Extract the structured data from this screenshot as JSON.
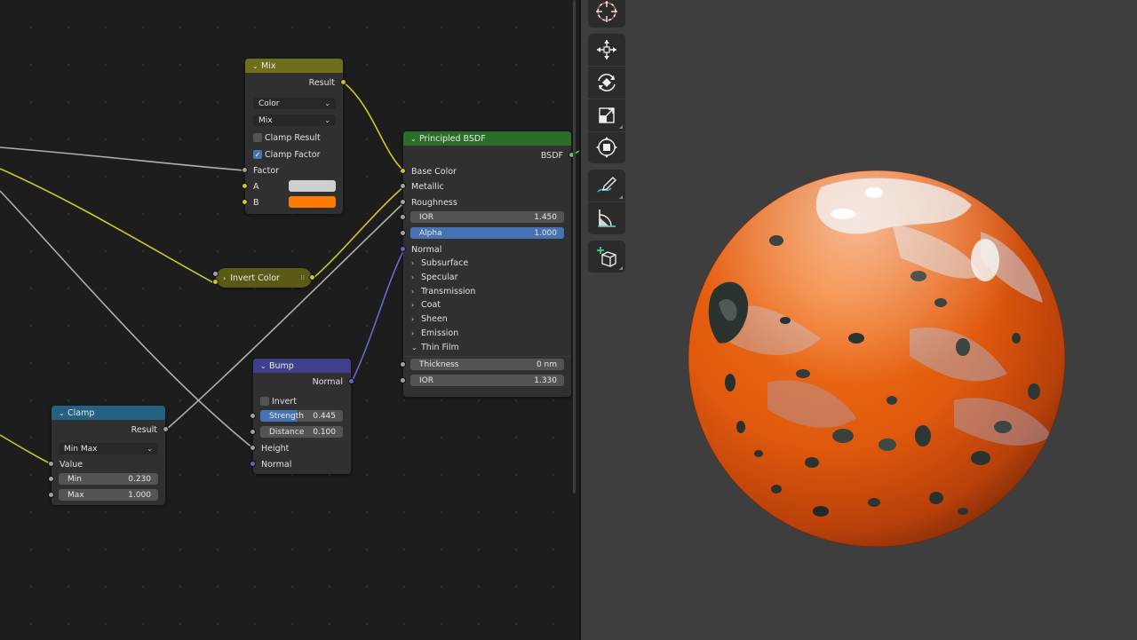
{
  "node_editor": {
    "mix_node": {
      "title": "Mix",
      "output_result": "Result",
      "data_type": "Color",
      "blend_mode": "Mix",
      "clamp_result_label": "Clamp Result",
      "clamp_result_checked": false,
      "clamp_factor_label": "Clamp Factor",
      "clamp_factor_checked": true,
      "input_factor": "Factor",
      "input_a": "A",
      "input_b": "B",
      "color_a": "#cfcfcf",
      "color_b": "#ff7b00",
      "header_color": "#6e6e1c"
    },
    "invert_node": {
      "title": "Invert Color",
      "header_color": "#5a5a17"
    },
    "principled_node": {
      "title": "Principled BSDF",
      "output_bsdf": "BSDF",
      "input_base_color": "Base Color",
      "input_metallic": "Metallic",
      "input_roughness": "Roughness",
      "ior_label": "IOR",
      "ior_value": "1.450",
      "alpha_label": "Alpha",
      "alpha_value": "1.000",
      "alpha_fill": 1.0,
      "input_normal": "Normal",
      "panels": [
        "Subsurface",
        "Specular",
        "Transmission",
        "Coat",
        "Sheen",
        "Emission"
      ],
      "thin_film_panel": "Thin Film",
      "thickness_label": "Thickness",
      "thickness_value": "0 nm",
      "thin_film_ior_label": "IOR",
      "thin_film_ior_value": "1.330",
      "header_color": "#2b6d2b"
    },
    "bump_node": {
      "title": "Bump",
      "output_normal": "Normal",
      "invert_label": "Invert",
      "invert_checked": false,
      "strength_label": "Strength",
      "strength_value": "0.445",
      "strength_fill": 0.445,
      "distance_label": "Distance",
      "distance_value": "0.100",
      "input_height": "Height",
      "input_normal": "Normal",
      "header_color": "#3f3f8a"
    },
    "clamp_node": {
      "title": "Clamp",
      "output_result": "Result",
      "clamp_type": "Min Max",
      "input_value": "Value",
      "min_label": "Min",
      "min_value": "0.230",
      "max_label": "Max",
      "max_value": "1.000",
      "header_color": "#246283"
    }
  },
  "viewport": {
    "background": "#3e3e3e",
    "tools": [
      "cursor-tool-icon",
      "move-tool-icon",
      "rotate-tool-icon",
      "scale-tool-icon",
      "transform-tool-icon",
      "annotate-tool-icon",
      "measure-tool-icon",
      "add-cube-tool-icon"
    ],
    "sphere_base_color": "#e0590d"
  }
}
